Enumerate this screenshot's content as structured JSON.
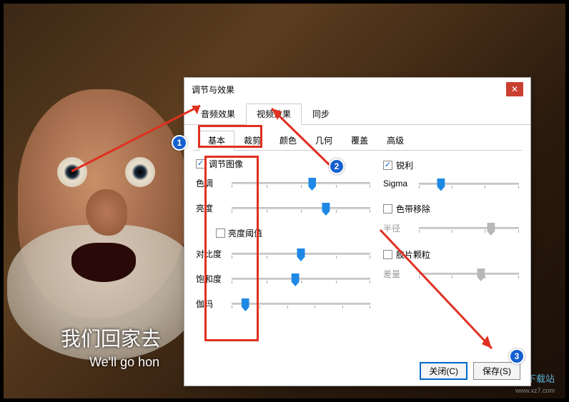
{
  "subtitle": {
    "cn": "我们回家去",
    "en": "We'll go hon"
  },
  "watermark": {
    "text": "极光下载站",
    "sub": "www.xz7.com"
  },
  "dialog": {
    "title": "调节与效果",
    "tabs_main": [
      "音频效果",
      "视频效果",
      "同步"
    ],
    "tabs_sub": [
      "基本",
      "裁剪",
      "颜色",
      "几何",
      "覆盖",
      "高级"
    ],
    "adjust_image": "调节图像",
    "sliders": {
      "hue": "色调",
      "brightness": "亮度",
      "bright_threshold": "亮度阈值",
      "contrast": "对比度",
      "saturation": "饱和度",
      "gamma": "伽玛"
    },
    "right": {
      "sharpen": "锐利",
      "sigma": "Sigma",
      "banding": "色带移除",
      "radius": "半径",
      "grain": "胶片颗粒",
      "variance": "差量"
    },
    "btn_close": "关闭(C)",
    "btn_save": "保存(S)"
  },
  "badges": {
    "b1": "1",
    "b2": "2",
    "b3": "3"
  }
}
